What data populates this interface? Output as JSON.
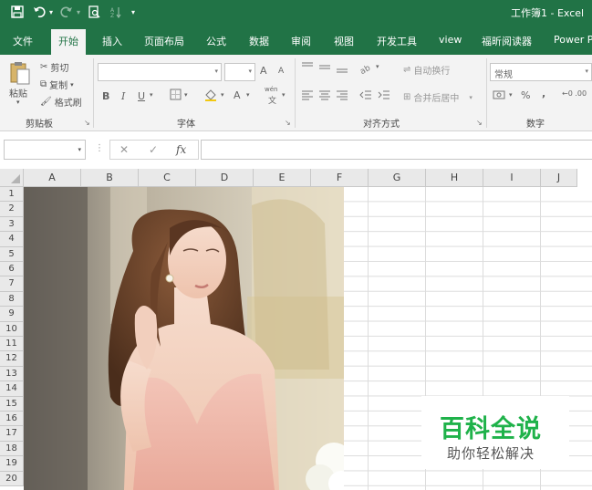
{
  "window": {
    "title": "工作簿1 - Excel"
  },
  "tabs": [
    {
      "label": "文件"
    },
    {
      "label": "开始"
    },
    {
      "label": "插入"
    },
    {
      "label": "页面布局"
    },
    {
      "label": "公式"
    },
    {
      "label": "数据"
    },
    {
      "label": "审阅"
    },
    {
      "label": "视图"
    },
    {
      "label": "开发工具"
    },
    {
      "label": "view"
    },
    {
      "label": "福昕阅读器"
    },
    {
      "label": "Power P"
    }
  ],
  "active_tab": "开始",
  "clipboard": {
    "paste": "粘贴",
    "cut": "剪切",
    "copy": "复制",
    "format_painter": "格式刷",
    "group": "剪贴板"
  },
  "font": {
    "group": "字体",
    "font_name": "",
    "font_size": "",
    "bold": "B",
    "italic": "I",
    "underline": "U",
    "increase": "A",
    "decrease": "A",
    "font_color": "A",
    "phonetic_top": "wén",
    "phonetic_bottom": "文"
  },
  "alignment": {
    "wrap_text": "自动换行",
    "merge_center": "合并后居中",
    "group": "对齐方式"
  },
  "number": {
    "format": "常规",
    "percent": "%",
    "comma": ",",
    "dec_inc": "←0 .00",
    "group": "数字"
  },
  "formula_bar": {
    "name_box": "",
    "cancel": "✕",
    "enter": "✓",
    "fx": "fx",
    "content": ""
  },
  "columns": [
    "A",
    "B",
    "C",
    "D",
    "E",
    "F",
    "G",
    "H",
    "I",
    "J"
  ],
  "rows": [
    "1",
    "2",
    "3",
    "4",
    "5",
    "6",
    "7",
    "8",
    "9",
    "10",
    "11",
    "12",
    "13",
    "14",
    "15",
    "16",
    "17",
    "18",
    "19",
    "20"
  ],
  "watermark": {
    "title": "百科全说",
    "subtitle": "助你轻松解决"
  },
  "colors": {
    "excel_green": "#217346",
    "ribbon_bg": "#f3f3f3",
    "watermark_green": "#1fb24a"
  }
}
